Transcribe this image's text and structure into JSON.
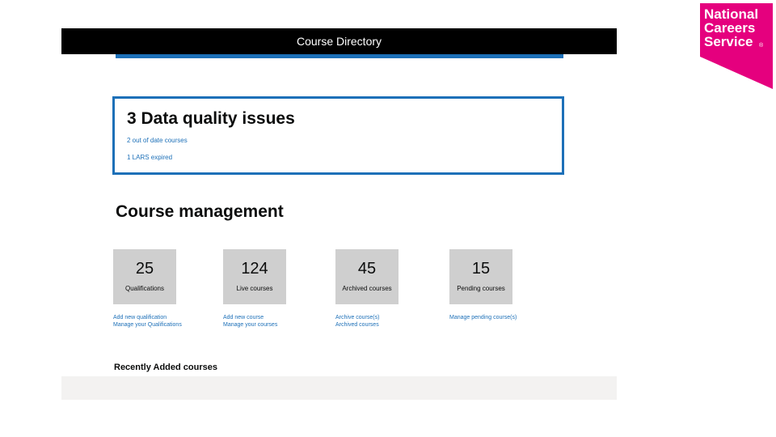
{
  "header": {
    "title": "Course Directory"
  },
  "logo": {
    "line1": "National",
    "line2": "Careers",
    "line3": "Service",
    "mark": "®",
    "color": "#e5007e"
  },
  "data_quality": {
    "title": "3 Data quality issues",
    "links": [
      "2 out of date courses",
      "1 LARS expired"
    ]
  },
  "course_management": {
    "title": "Course management",
    "tiles": [
      {
        "count": "25",
        "label": "Qualifications",
        "links": [
          "Add new qualification",
          "Manage your Qualifications"
        ]
      },
      {
        "count": "124",
        "label": "Live courses",
        "links": [
          "Add new course",
          "Manage your courses"
        ]
      },
      {
        "count": "45",
        "label": "Archived courses",
        "links": [
          "Archive course(s)",
          "Archived courses"
        ]
      },
      {
        "count": "15",
        "label": "Pending courses",
        "links": [
          "Manage pending course(s)"
        ]
      }
    ]
  },
  "recent": {
    "title": "Recently Added courses"
  },
  "colors": {
    "accent": "#1d70b8",
    "header_bg": "#000000",
    "tile_bg": "#cfcfcf"
  }
}
